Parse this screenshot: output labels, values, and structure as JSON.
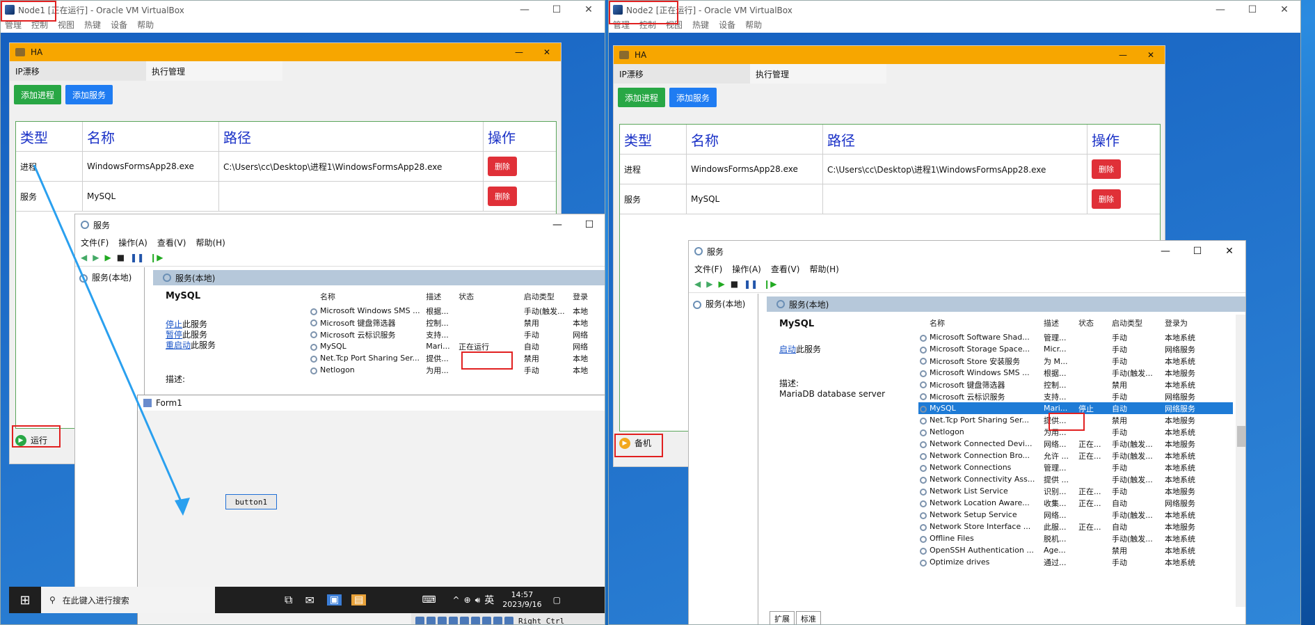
{
  "node1": {
    "title": "Node1 [正在运行] - Oracle VM VirtualBox",
    "menu": [
      "管理",
      "控制",
      "视图",
      "热键",
      "设备",
      "帮助"
    ],
    "window_controls": [
      "—",
      "☐",
      "✕"
    ]
  },
  "node2": {
    "title": "Node2 [正在运行] - Oracle VM VirtualBox",
    "menu": [
      "管理",
      "控制",
      "视图",
      "热键",
      "设备",
      "帮助"
    ],
    "window_controls": [
      "—",
      "☐",
      "✕"
    ]
  },
  "ha": {
    "title": "HA",
    "controls": [
      "—",
      "✕"
    ],
    "tabs": [
      "IP漂移",
      "执行管理"
    ],
    "buttons": {
      "add_process": "添加进程",
      "add_service": "添加服务"
    },
    "headers": [
      "类型",
      "名称",
      "路径",
      "操作"
    ],
    "rows": [
      {
        "type": "进程",
        "name": "WindowsFormsApp28.exe",
        "path": "C:\\Users\\cc\\Desktop\\进程1\\WindowsFormsApp28.exe",
        "action": "删除"
      },
      {
        "type": "服务",
        "name": "MySQL",
        "path": "",
        "action": "删除"
      }
    ]
  },
  "status1": {
    "label": "运行",
    "color": "#28a745"
  },
  "status2": {
    "label": "备机",
    "color": "#f2a81d"
  },
  "svc1": {
    "title": "服务",
    "controls": [
      "—",
      "☐"
    ],
    "menu": [
      "文件(F)",
      "操作(A)",
      "查看(V)",
      "帮助(H)"
    ],
    "tree_item": "服务(本地)",
    "header": "服务(本地)",
    "selected_name": "MySQL",
    "link_stop": "停止",
    "link_stop_rest": "此服务",
    "link_pause": "暂停",
    "link_pause_rest": "此服务",
    "link_restart": "重启动",
    "link_restart_rest": "此服务",
    "desc_label": "描述:",
    "columns": [
      "名称",
      "描述",
      "状态",
      "启动类型",
      "登录"
    ],
    "rows": [
      {
        "name": "Microsoft Windows SMS ...",
        "desc": "根据...",
        "status": "",
        "start": "手动(触发...",
        "logon": "本地"
      },
      {
        "name": "Microsoft 键盘筛选器",
        "desc": "控制...",
        "status": "",
        "start": "禁用",
        "logon": "本地"
      },
      {
        "name": "Microsoft 云标识服务",
        "desc": "支持...",
        "status": "",
        "start": "手动",
        "logon": "网络"
      },
      {
        "name": "MySQL",
        "desc": "Mari...",
        "status": "正在运行",
        "start": "自动",
        "logon": "网络"
      },
      {
        "name": "Net.Tcp Port Sharing Ser...",
        "desc": "提供...",
        "status": "",
        "start": "禁用",
        "logon": "本地"
      },
      {
        "name": "Netlogon",
        "desc": "为用...",
        "status": "",
        "start": "手动",
        "logon": "本地"
      }
    ]
  },
  "form1": {
    "title": "Form1",
    "button": "button1"
  },
  "taskbar1": {
    "search": "在此键入进行搜索",
    "time": "14:57",
    "date": "2023/9/16",
    "lang": "英"
  },
  "vmstatus1": {
    "hostkey": "Right Ctrl"
  },
  "svc2": {
    "title": "服务",
    "controls": [
      "—",
      "☐",
      "✕"
    ],
    "menu": [
      "文件(F)",
      "操作(A)",
      "查看(V)",
      "帮助(H)"
    ],
    "tree_item": "服务(本地)",
    "header": "服务(本地)",
    "selected_name": "MySQL",
    "link_start": "启动",
    "link_start_rest": "此服务",
    "desc_label": "描述:",
    "desc_text": "MariaDB database server",
    "columns": [
      "名称",
      "描述",
      "状态",
      "启动类型",
      "登录为"
    ],
    "rows": [
      {
        "name": "Microsoft Software Shad...",
        "desc": "管理...",
        "status": "",
        "start": "手动",
        "logon": "本地系统"
      },
      {
        "name": "Microsoft Storage Space...",
        "desc": "Micr...",
        "status": "",
        "start": "手动",
        "logon": "网络服务"
      },
      {
        "name": "Microsoft Store 安装服务",
        "desc": "为 M...",
        "status": "",
        "start": "手动",
        "logon": "本地系统"
      },
      {
        "name": "Microsoft Windows SMS ...",
        "desc": "根据...",
        "status": "",
        "start": "手动(触发...",
        "logon": "本地服务"
      },
      {
        "name": "Microsoft 键盘筛选器",
        "desc": "控制...",
        "status": "",
        "start": "禁用",
        "logon": "本地系统"
      },
      {
        "name": "Microsoft 云标识服务",
        "desc": "支持...",
        "status": "",
        "start": "手动",
        "logon": "网络服务"
      },
      {
        "name": "MySQL",
        "desc": "Mari...",
        "status": "停止",
        "start": "自动",
        "logon": "网络服务"
      },
      {
        "name": "Net.Tcp Port Sharing Ser...",
        "desc": "提供...",
        "status": "",
        "start": "禁用",
        "logon": "本地服务"
      },
      {
        "name": "Netlogon",
        "desc": "为用...",
        "status": "",
        "start": "手动",
        "logon": "本地系统"
      },
      {
        "name": "Network Connected Devi...",
        "desc": "网络...",
        "status": "正在...",
        "start": "手动(触发...",
        "logon": "本地服务"
      },
      {
        "name": "Network Connection Bro...",
        "desc": "允许 ...",
        "status": "正在...",
        "start": "手动(触发...",
        "logon": "本地系统"
      },
      {
        "name": "Network Connections",
        "desc": "管理...",
        "status": "",
        "start": "手动",
        "logon": "本地系统"
      },
      {
        "name": "Network Connectivity Ass...",
        "desc": "提供 ...",
        "status": "",
        "start": "手动(触发...",
        "logon": "本地系统"
      },
      {
        "name": "Network List Service",
        "desc": "识别...",
        "status": "正在...",
        "start": "手动",
        "logon": "本地服务"
      },
      {
        "name": "Network Location Aware...",
        "desc": "收集...",
        "status": "正在...",
        "start": "自动",
        "logon": "网络服务"
      },
      {
        "name": "Network Setup Service",
        "desc": "网络...",
        "status": "",
        "start": "手动(触发...",
        "logon": "本地系统"
      },
      {
        "name": "Network Store Interface ...",
        "desc": "此服...",
        "status": "正在...",
        "start": "自动",
        "logon": "本地服务"
      },
      {
        "name": "Offline Files",
        "desc": "脱机...",
        "status": "",
        "start": "手动(触发...",
        "logon": "本地系统"
      },
      {
        "name": "OpenSSH Authentication ...",
        "desc": "Age...",
        "status": "",
        "start": "禁用",
        "logon": "本地系统"
      },
      {
        "name": "Optimize drives",
        "desc": "通过...",
        "status": "",
        "start": "手动",
        "logon": "本地系统"
      }
    ],
    "bottom_tabs": [
      "扩展",
      "标准"
    ]
  }
}
